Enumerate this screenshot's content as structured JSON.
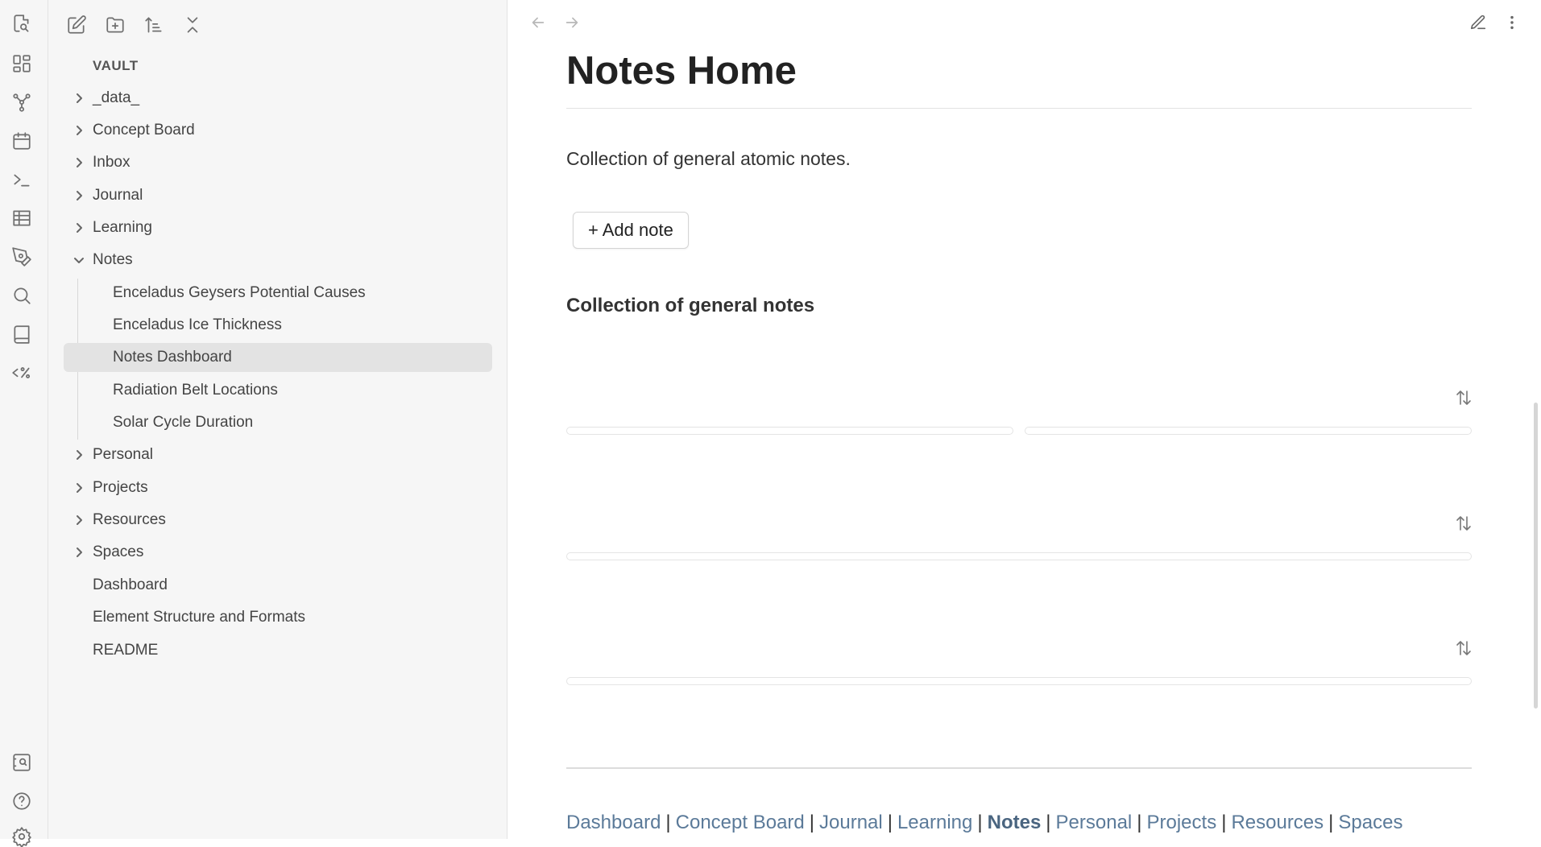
{
  "sidebar": {
    "vault_label": "VAULT",
    "tree": {
      "folders_top": [
        "_data_",
        "Concept Board",
        "Inbox",
        "Journal",
        "Learning"
      ],
      "open_folder": "Notes",
      "open_children": [
        "Enceladus Geysers Potential Causes",
        "Enceladus Ice Thickness",
        "Notes Dashboard",
        "Radiation Belt Locations",
        "Solar Cycle Duration"
      ],
      "active_item": "Notes Dashboard",
      "folders_bottom": [
        "Personal",
        "Projects",
        "Resources",
        "Spaces"
      ],
      "files": [
        "Dashboard",
        "Element Structure and Formats",
        "README"
      ]
    }
  },
  "main": {
    "title": "Notes Home",
    "description": "Collection of general atomic notes.",
    "add_button": "+ Add note",
    "section_heading": "Collection of general notes",
    "footer_nav": {
      "items": [
        "Dashboard",
        "Concept Board",
        "Journal",
        "Learning",
        "Notes",
        "Personal",
        "Projects",
        "Resources",
        "Spaces"
      ],
      "current": "Notes",
      "separator": "|"
    }
  },
  "icons": {
    "ribbon_top": [
      "search-file-icon",
      "canvas-grid-icon",
      "graph-view-icon",
      "calendar-icon",
      "terminal-icon",
      "table-icon",
      "pen-icon",
      "search-icon",
      "book-icon",
      "templater-icon"
    ],
    "ribbon_bottom": [
      "vault-switch-icon",
      "help-icon",
      "settings-icon"
    ],
    "sidebar_toolbar": [
      "new-note-icon",
      "new-folder-icon",
      "sort-icon",
      "collapse-all-icon"
    ],
    "header": [
      "back-arrow-icon",
      "forward-arrow-icon",
      "edit-pencil-icon",
      "more-options-icon"
    ]
  },
  "colors": {
    "accent_link": "#5b7a99",
    "sidebar_bg": "#f6f6f6",
    "active_item_bg": "#e3e3e3"
  }
}
